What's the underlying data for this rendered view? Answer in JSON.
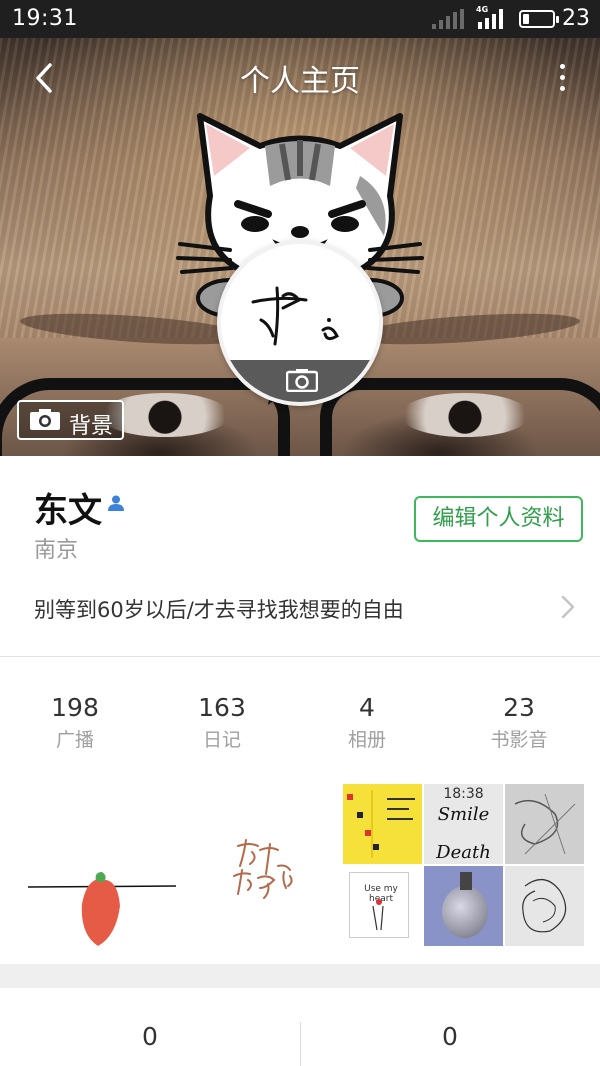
{
  "status_bar": {
    "time": "19:31",
    "battery_text": "23",
    "battery_level": 0.23,
    "network_label": "4G",
    "icons": [
      "signal-empty-icon",
      "signal-4g-icon",
      "battery-icon"
    ]
  },
  "header": {
    "title": "个人主页",
    "back_icon": "back-arrow-icon",
    "more_icon": "more-vertical-icon",
    "background_button_label": "背景",
    "background_button_icon": "camera-icon",
    "avatar_camera_icon": "camera-icon"
  },
  "profile": {
    "name": "东文",
    "verified_icon": "user-verified-icon",
    "city": "南京",
    "edit_button_label": "编辑个人资料",
    "signature": "别等到60岁以后/才去寻找我想要的自由"
  },
  "stats": [
    {
      "value": "198",
      "label": "广播"
    },
    {
      "value": "163",
      "label": "日记"
    },
    {
      "value": "4",
      "label": "相册"
    },
    {
      "value": "23",
      "label": "书影音"
    }
  ],
  "album_tile_texts": {
    "tile2_time": "18:38",
    "tile2_word1": "Smile",
    "tile2_word2": "Death",
    "tile4_text": "Use my heart"
  },
  "bottom_stats": [
    {
      "value": "0"
    },
    {
      "value": "0"
    }
  ],
  "colors": {
    "accent_green": "#3fb75b",
    "verified_blue": "#3b82d8",
    "status_bar_bg": "#1f1f1f"
  }
}
